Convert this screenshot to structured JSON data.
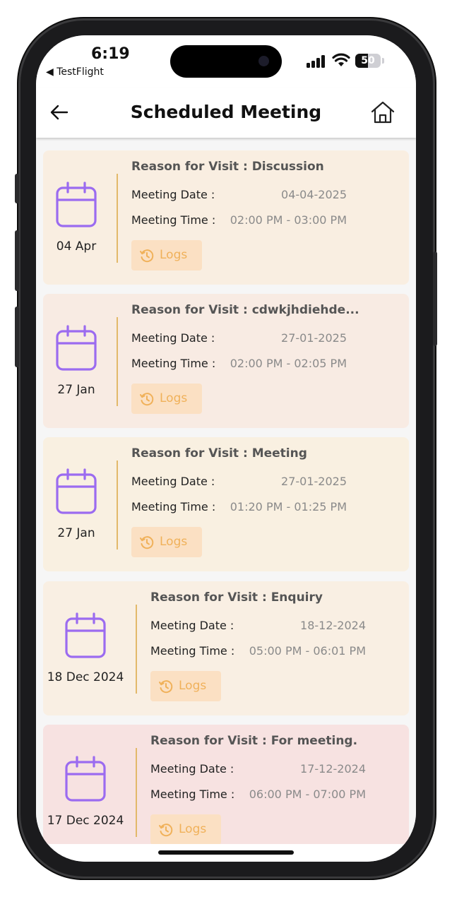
{
  "status": {
    "time": "6:19",
    "back_app": "◀ TestFlight",
    "battery": "50",
    "battery_level": 0.5
  },
  "header": {
    "title": "Scheduled Meeting",
    "back_icon": "arrow-left-icon",
    "home_icon": "home-icon"
  },
  "labels": {
    "reason_prefix": "Reason for Visit : ",
    "meeting_date": "Meeting Date :",
    "meeting_time": "Meeting Time :",
    "logs": "Logs"
  },
  "meetings": [
    {
      "date_label": "04 Apr",
      "reason": "Discussion",
      "meeting_date": "04-04-2025",
      "meeting_time": "02:00 PM - 03:00 PM",
      "bg": "#f9eee1"
    },
    {
      "date_label": "27 Jan",
      "reason": "cdwkjhdiehde...",
      "meeting_date": "27-01-2025",
      "meeting_time": "02:00 PM - 02:05 PM",
      "bg": "#f8ebe3"
    },
    {
      "date_label": "27 Jan",
      "reason": "Meeting",
      "meeting_date": "27-01-2025",
      "meeting_time": "01:20 PM - 01:25 PM",
      "bg": "#f9f0e1"
    },
    {
      "date_label": "18 Dec 2024",
      "reason": "Enquiry",
      "meeting_date": "18-12-2024",
      "meeting_time": "05:00 PM - 06:01 PM",
      "bg": "#f9efe3"
    },
    {
      "date_label": "17 Dec 2024",
      "reason": "For meeting.",
      "meeting_date": "17-12-2024",
      "meeting_time": "06:00 PM - 07:00 PM",
      "bg": "#f7e2e1"
    }
  ],
  "colors": {
    "calendar_icon": "#9b6bf0",
    "divider": "#e2b96a",
    "logs_text": "#f0b15a",
    "logs_bg": "#fbe0c3"
  }
}
